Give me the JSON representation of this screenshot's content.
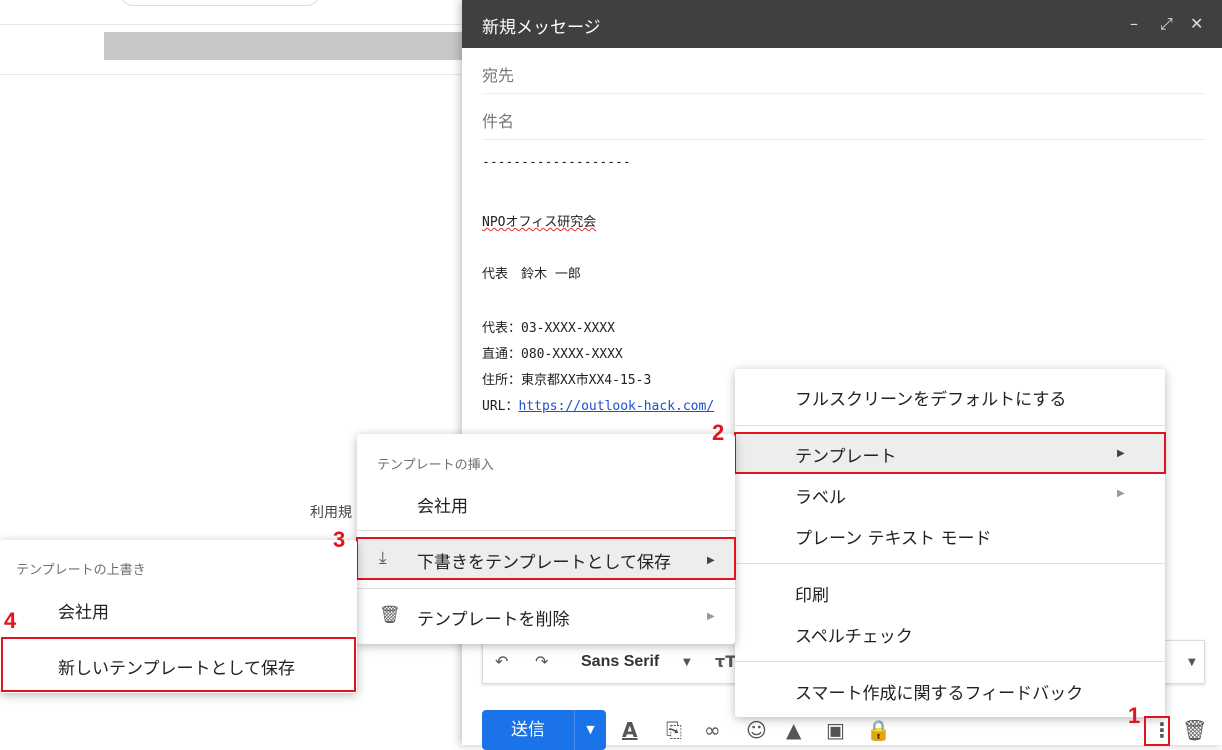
{
  "compose": {
    "title": "新規メッセージ",
    "to_placeholder": "宛先",
    "subject_placeholder": "件名",
    "body": {
      "dashes": "-------------------",
      "org": "NPOオフィス研究会",
      "rep": "代表　鈴木 一郎",
      "tel_main": "代表：03-XXXX-XXXX",
      "tel_direct": "直通：080-XXXX-XXXX",
      "address": "住所：東京都XX市XX4-15-3",
      "url_label": "URL：",
      "url": "https://outlook-hack.com/"
    },
    "font": "Sans Serif",
    "send": "送信"
  },
  "background": {
    "terms": "利用規"
  },
  "more_menu": {
    "fullscreen_default": "フルスクリーンをデフォルトにする",
    "template": "テンプレート",
    "label": "ラベル",
    "plain_text": "プレーン テキスト モード",
    "print": "印刷",
    "spellcheck": "スペルチェック",
    "feedback": "スマート作成に関するフィードバック"
  },
  "template_menu": {
    "insert_header": "テンプレートの挿入",
    "insert_item": "会社用",
    "save_draft": "下書きをテンプレートとして保存",
    "delete": "テンプレートを削除"
  },
  "overwrite_menu": {
    "header": "テンプレートの上書き",
    "item": "会社用",
    "save_new": "新しいテンプレートとして保存"
  },
  "steps": [
    "1",
    "2",
    "3",
    "4"
  ],
  "colors": {
    "accent_red": "#e0141e",
    "send_blue": "#1a73e8",
    "header_dark": "#404040"
  }
}
